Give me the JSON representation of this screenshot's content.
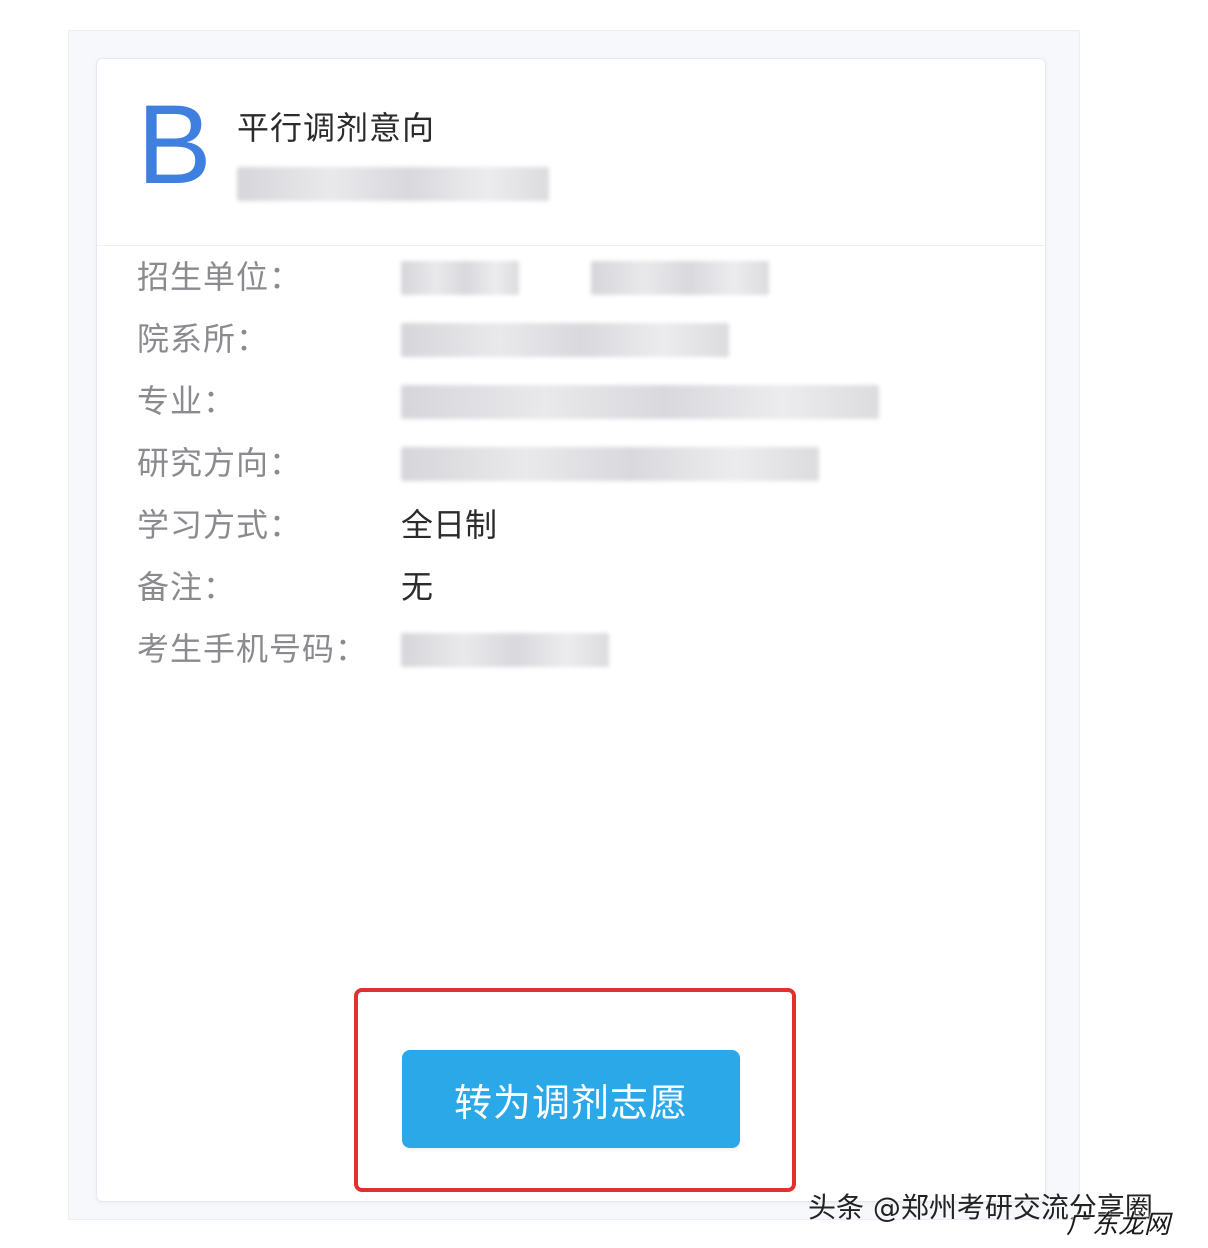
{
  "card": {
    "badge_letter": "B",
    "title": "平行调剂意向"
  },
  "fields": [
    {
      "label": "招生单位：",
      "value": null
    },
    {
      "label": "院系所：",
      "value": null
    },
    {
      "label": "专业：",
      "value": null
    },
    {
      "label": "研究方向：",
      "value": null
    },
    {
      "label": "学习方式：",
      "value": "全日制"
    },
    {
      "label": "备注：",
      "value": "无"
    },
    {
      "label": "考生手机号码：",
      "value": null
    }
  ],
  "actions": {
    "convert_label": "转为调剂志愿"
  },
  "watermark": {
    "source": "头条 @郑州考研交流分享圈",
    "stamp": "广东龙网"
  },
  "colors": {
    "accent_letter": "#3f7fe0",
    "button": "#2aa8e8",
    "highlight_border": "#e0312e"
  }
}
